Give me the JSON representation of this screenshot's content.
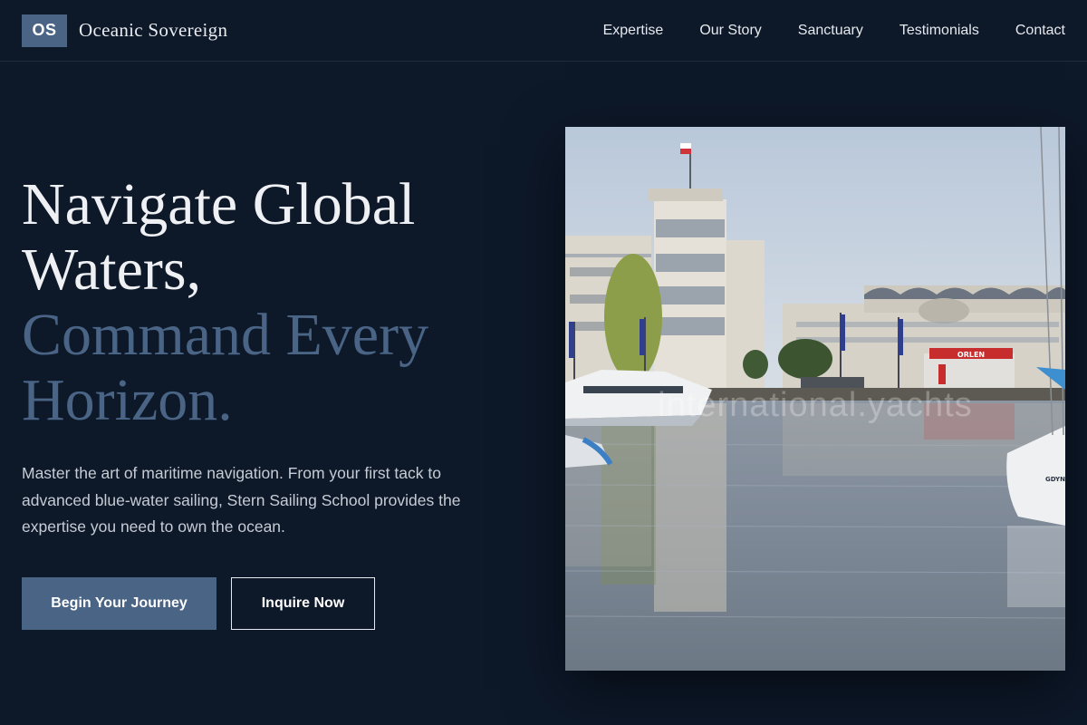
{
  "brand": {
    "logo_text": "OS",
    "name": "Oceanic Sovereign"
  },
  "nav": {
    "links": [
      "Expertise",
      "Our Story",
      "Sanctuary",
      "Testimonials",
      "Contact"
    ]
  },
  "hero": {
    "headline_line1": "Navigate Global",
    "headline_line2": "Waters,",
    "headline_line3": "Command Every",
    "headline_line4": "Horizon.",
    "lead": "Master the art of maritime navigation. From your first tack to advanced blue-water sailing, Stern Sailing School provides the expertise you need to own the ocean.",
    "primary_cta": "Begin Your Journey",
    "secondary_cta": "Inquire Now"
  },
  "image": {
    "watermark": "international.yachts",
    "building_sign": "ORLEN",
    "boat_name": "GDYNI"
  },
  "colors": {
    "background": "#0d1829",
    "accent": "#4a6485",
    "text": "#e8ebef"
  }
}
